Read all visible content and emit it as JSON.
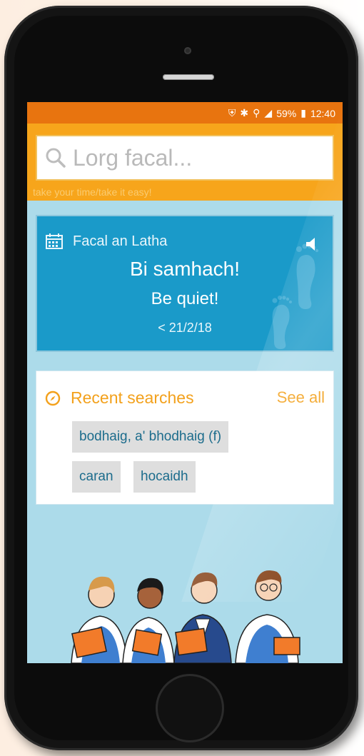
{
  "status_bar": {
    "battery": "59%",
    "time": "12:40",
    "icons": [
      "notification-icon",
      "bluetooth-icon",
      "wifi-icon",
      "signal-icon",
      "battery-icon"
    ]
  },
  "search": {
    "placeholder": "Lorg facal..."
  },
  "header": {
    "ghost_subtitle": "take your time/take it easy!"
  },
  "word_of_day": {
    "title": "Facal an Latha",
    "gaelic": "Bi samhach!",
    "english": "Be quiet!",
    "date": "< 21/2/18"
  },
  "recent": {
    "title": "Recent searches",
    "see_all": "See all",
    "items": [
      "bodhaig, a' bhodhaig (f)",
      "caran",
      "hocaidh"
    ]
  },
  "colors": {
    "status_bar": "#e8740f",
    "header": "#f7a51b",
    "background": "#acdbea",
    "word_card": "#1a9ac9",
    "accent": "#f3a11c",
    "chip_text": "#1c6c8c"
  }
}
